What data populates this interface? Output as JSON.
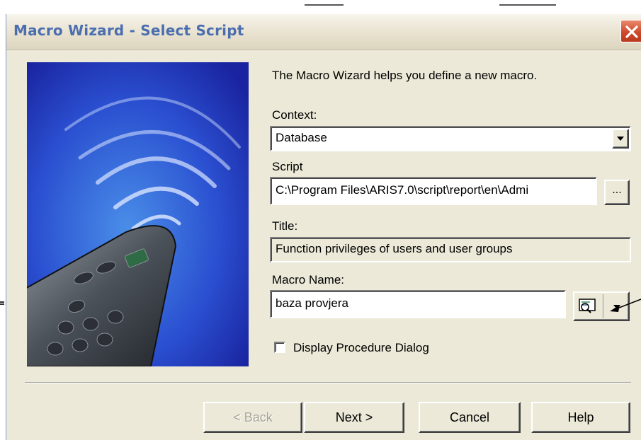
{
  "window": {
    "title": "Macro Wizard - Select Script"
  },
  "intro_text": "The Macro Wizard helps you define a new macro.",
  "context": {
    "label": "Context:",
    "value": "Database"
  },
  "script": {
    "label": "Script",
    "value": "C:\\Program Files\\ARIS7.0\\script\\report\\en\\Admi",
    "browse_label": "..."
  },
  "title_field": {
    "label": "Title:",
    "value": "Function privileges of users and user groups"
  },
  "macro_name": {
    "label": "Macro Name:",
    "value": "baza provjera"
  },
  "display_procedure": {
    "label": "Display Procedure Dialog",
    "checked": false
  },
  "buttons": {
    "back": "< Back",
    "next": "Next >",
    "cancel": "Cancel",
    "help": "Help"
  },
  "colors": {
    "title_text": "#4b6eaf",
    "dialog_bg": "#ece9d8",
    "close_red": "#cf4a2c",
    "art_blue": "#1f2fb0"
  },
  "icons": [
    "close-icon",
    "dropdown-arrow-icon",
    "ellipsis-icon",
    "icon-picker-icon",
    "remote-control-illustration"
  ]
}
